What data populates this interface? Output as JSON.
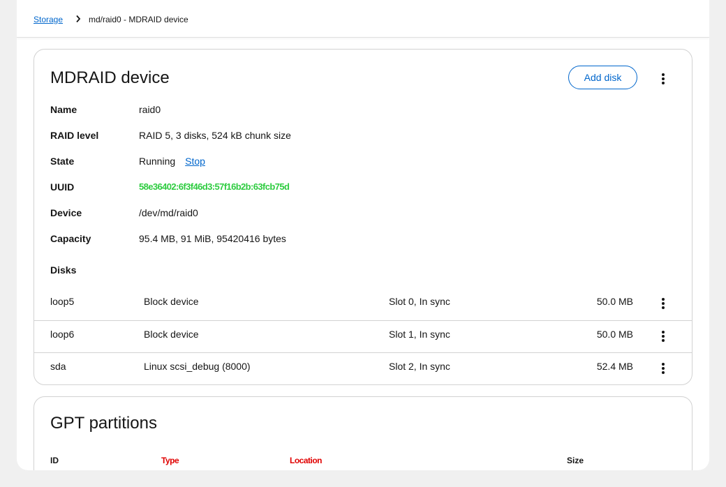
{
  "breadcrumb": {
    "root": "Storage",
    "current": "md/raid0 - MDRAID device"
  },
  "mdraid_card": {
    "title": "MDRAID device",
    "add_disk_label": "Add disk",
    "fields": {
      "name": {
        "label": "Name",
        "value": "raid0"
      },
      "raid_level": {
        "label": "RAID level",
        "value": "RAID 5, 3 disks, 524 kB chunk size"
      },
      "state": {
        "label": "State",
        "value": "Running",
        "action": "Stop"
      },
      "uuid": {
        "label": "UUID",
        "value": "58e36402:6f3f46d3:57f16b2b:63fcb75d"
      },
      "device": {
        "label": "Device",
        "value": "/dev/md/raid0"
      },
      "capacity": {
        "label": "Capacity",
        "value": "95.4 MB, 91 MiB, 95420416 bytes"
      }
    },
    "disks_label": "Disks",
    "disks": [
      {
        "name": "loop5",
        "type": "Block device",
        "slot": "Slot 0, In sync",
        "size": "50.0 MB"
      },
      {
        "name": "loop6",
        "type": "Block device",
        "slot": "Slot 1, In sync",
        "size": "50.0 MB"
      },
      {
        "name": "sda",
        "type": "Linux scsi_debug (8000)",
        "slot": "Slot 2, In sync",
        "size": "52.4 MB"
      }
    ]
  },
  "gpt_card": {
    "title": "GPT partitions",
    "columns": {
      "id": "ID",
      "type": "Type",
      "location": "Location",
      "size": "Size"
    }
  },
  "colors": {
    "link": "#0066cc",
    "uuid": "#2ecc40",
    "header_overlay": "#e00000"
  }
}
